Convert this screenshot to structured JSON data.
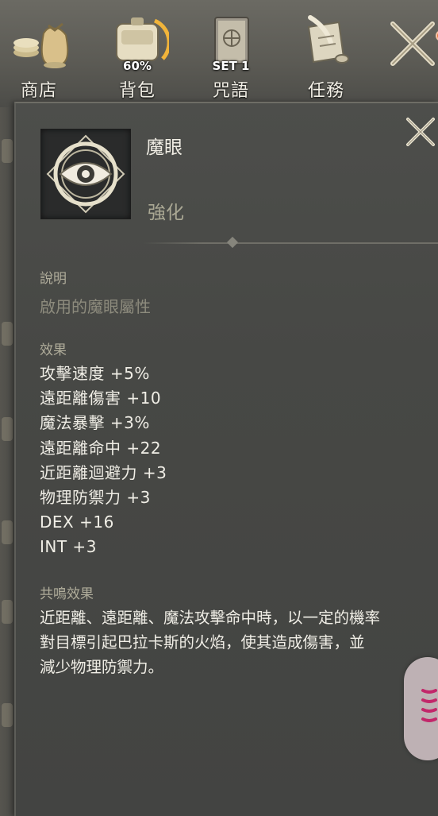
{
  "menu": [
    {
      "label": "商店",
      "icon": "money-bag-icon"
    },
    {
      "label": "背包",
      "icon": "backpack-icon",
      "badge": "60%"
    },
    {
      "label": "咒語",
      "icon": "spellbook-icon",
      "badge": "SET 1"
    },
    {
      "label": "任務",
      "icon": "quest-scroll-icon"
    }
  ],
  "menu_extra": {
    "icon": "crossed-swords-icon",
    "notification": true
  },
  "item": {
    "name": "魔眼",
    "type": "強化",
    "icon": "magic-eye-icon"
  },
  "description": {
    "title": "說明",
    "text": "啟用的魔眼屬性"
  },
  "effects": {
    "title": "效果",
    "list": [
      "攻擊速度 +5%",
      "遠距離傷害 +10",
      "魔法暴擊 +3%",
      "遠距離命中 +22",
      "近距離迴避力 +3",
      "物理防禦力 +3",
      "DEX +16",
      "INT +3"
    ]
  },
  "resonance": {
    "title": "共鳴效果",
    "lines": [
      "近距離、遠距離、魔法攻擊命中時，以一定的機率",
      "對目標引起巴拉卡斯的火焰，使其造成傷害，並",
      "減少物理防禦力。"
    ]
  },
  "colors": {
    "panel": "#474845",
    "text_primary": "#f0eee6",
    "text_muted": "#8d8b7d",
    "notify": "#e8743e"
  }
}
